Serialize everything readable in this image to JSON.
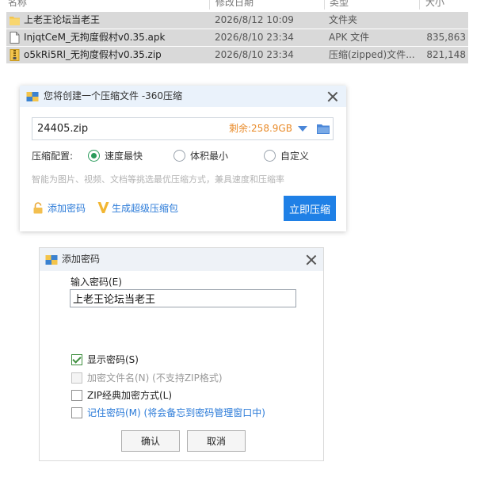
{
  "explorer": {
    "columns": [
      "名称",
      "修改日期",
      "类型",
      "大小"
    ],
    "files": [
      {
        "name": "上老王论坛当老王",
        "date": "2026/8/12 10:09",
        "type": "文件夹",
        "size": "",
        "icon": "folder-icon"
      },
      {
        "name": "InjqtCeM_无拘度假村v0.35.apk",
        "date": "2026/8/10 23:34",
        "type": "APK 文件",
        "size": "835,863",
        "icon": "file-icon"
      },
      {
        "name": "o5kRi5Rl_无拘度假村v0.35.zip",
        "date": "2026/8/10 23:34",
        "type": "压缩(zipped)文件...",
        "size": "821,148",
        "icon": "zip-icon"
      }
    ]
  },
  "compress_dialog": {
    "title": "您将创建一个压缩文件 -360压缩",
    "path_value": "24405.zip",
    "free_space": "剩余:258.9GB",
    "config_label": "压缩配置:",
    "options": [
      "速度最快",
      "体积最小",
      "自定义"
    ],
    "selected_option": "速度最快",
    "hint": "智能为图片、视频、文档等挑选最优压缩方式，兼具速度和压缩率",
    "add_password_label": "添加密码",
    "super_pack_label": "生成超级压缩包",
    "start_button": "立即压缩",
    "accent_color": "#1f80e6",
    "free_space_color": "#e98b2a"
  },
  "password_dialog": {
    "title": "添加密码",
    "input_label": "输入密码(E)",
    "password_value": "上老王论坛当老王",
    "checkboxes": [
      {
        "label": "显示密码(S)",
        "checked": true,
        "disabled": false
      },
      {
        "label": "加密文件名(N) (不支持ZIP格式)",
        "checked": false,
        "disabled": true
      },
      {
        "label": "ZIP经典加密方式(L)",
        "checked": false,
        "disabled": false
      },
      {
        "label": "记住密码(M) (将会备忘到密码管理窗口中)",
        "checked": false,
        "disabled": false
      }
    ],
    "ok_button": "确认",
    "cancel_button": "取消"
  }
}
